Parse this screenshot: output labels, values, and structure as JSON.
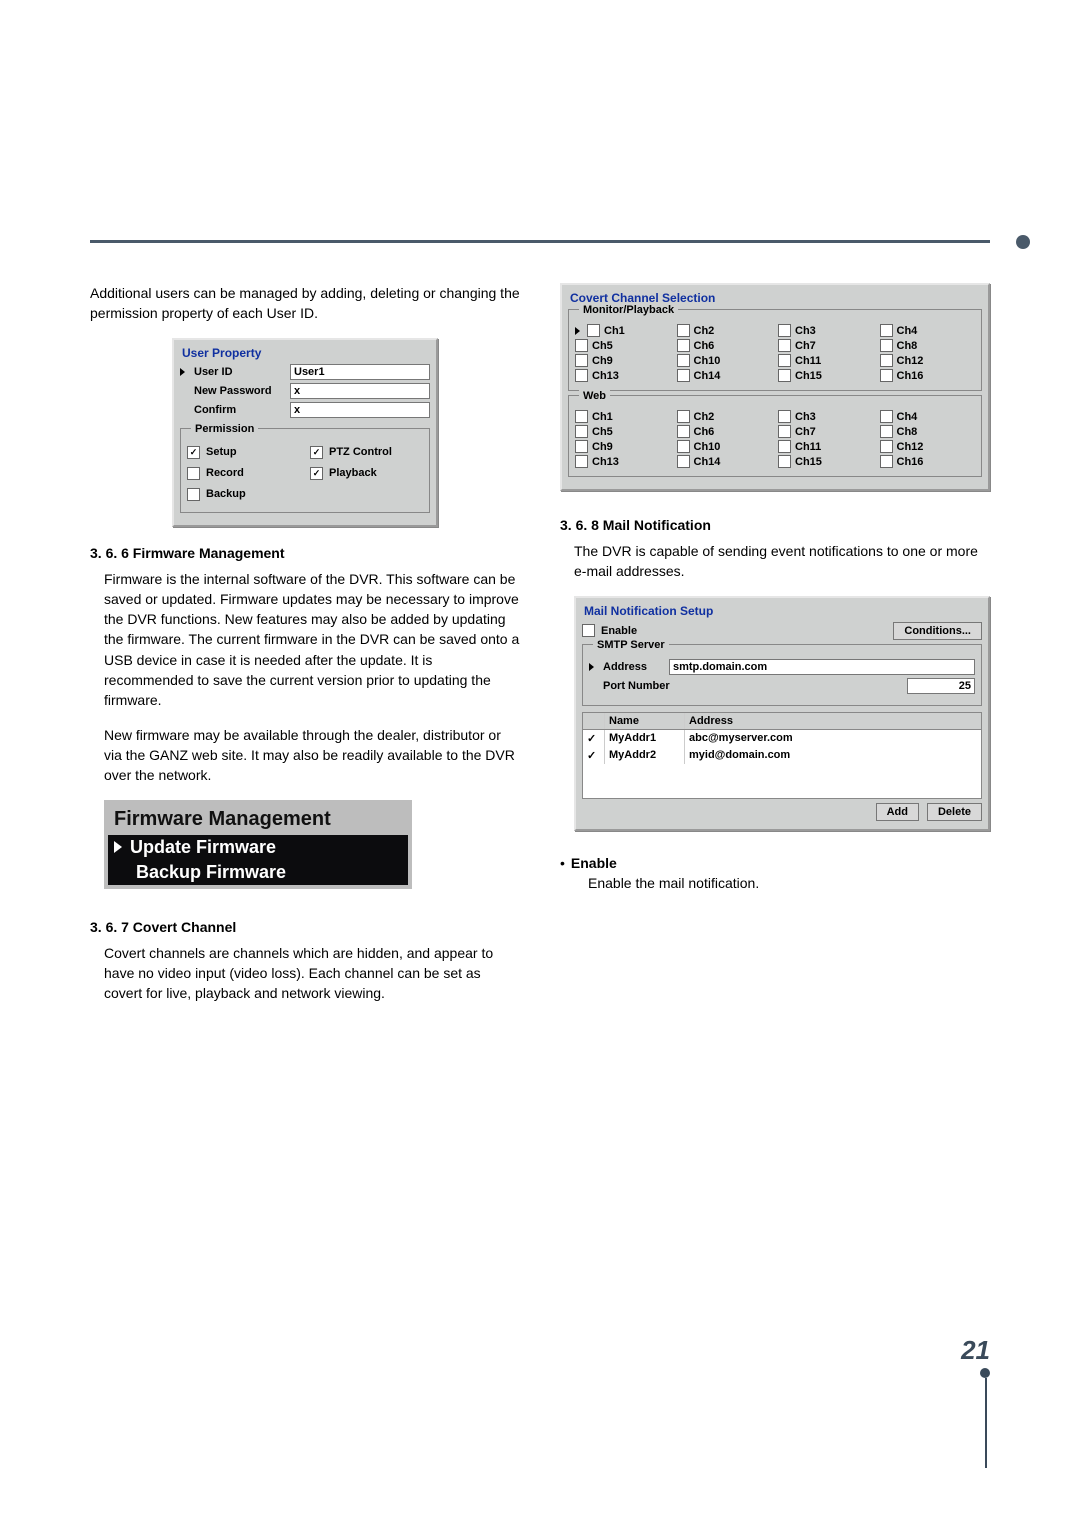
{
  "intro_para": "Additional users can be managed by adding, deleting or changing the permission property of each User ID.",
  "user_property": {
    "title": "User Property",
    "labels": {
      "user_id": "User ID",
      "new_password": "New Password",
      "confirm": "Confirm",
      "permission": "Permission"
    },
    "values": {
      "user_id": "User1",
      "new_password": "x",
      "confirm": "x"
    },
    "permissions": {
      "setup": "Setup",
      "record": "Record",
      "backup": "Backup",
      "ptz": "PTZ Control",
      "playback": "Playback"
    },
    "checked": {
      "setup": true,
      "record": false,
      "backup": false,
      "ptz": true,
      "playback": true
    }
  },
  "sections": {
    "firmware_title": "3. 6. 6 Firmware Management",
    "firmware_p1": "Firmware is the internal software of the DVR. This software can be saved or updated. Firmware updates may be necessary to improve the DVR functions. New features may also be added by updating the firmware. The current firmware in the DVR can be saved onto a USB device in case it is needed after the update. It is recommended to save the current version prior to updating the firmware.",
    "firmware_p2": "New firmware may be available through the dealer, distributor or via the GANZ web site. It may also be readily available to the DVR over the network.",
    "fw_panel_title": "Firmware Management",
    "fw_update": "Update Firmware",
    "fw_backup": "Backup Firmware",
    "covert_title": "3. 6. 7 Covert Channel",
    "covert_p": "Covert channels are channels which are hidden, and appear to have no video input (video loss). Each channel can be set as covert for live, playback and network viewing.",
    "mail_title": "3. 6. 8 Mail Notification",
    "mail_p": "The DVR is capable of sending event notifications to one or more e-mail addresses.",
    "enable_h": "Enable",
    "enable_p": "Enable the mail notification."
  },
  "covert_panel": {
    "title": "Covert Channel Selection",
    "group1": "Monitor/Playback",
    "group2": "Web",
    "channels": [
      "Ch1",
      "Ch2",
      "Ch3",
      "Ch4",
      "Ch5",
      "Ch6",
      "Ch7",
      "Ch8",
      "Ch9",
      "Ch10",
      "Ch11",
      "Ch12",
      "Ch13",
      "Ch14",
      "Ch15",
      "Ch16"
    ]
  },
  "mail_panel": {
    "title": "Mail Notification Setup",
    "enable": "Enable",
    "conditions": "Conditions...",
    "smtp_legend": "SMTP Server",
    "address_label": "Address",
    "address_value": "smtp.domain.com",
    "port_label": "Port Number",
    "port_value": "25",
    "cols": {
      "blank": "",
      "name": "Name",
      "addr": "Address"
    },
    "rows": [
      {
        "chk": "✓",
        "name": "MyAddr1",
        "addr": "abc@myserver.com"
      },
      {
        "chk": "✓",
        "name": "MyAddr2",
        "addr": "myid@domain.com"
      }
    ],
    "add": "Add",
    "delete": "Delete"
  },
  "page_number": "21",
  "bullet": "•"
}
